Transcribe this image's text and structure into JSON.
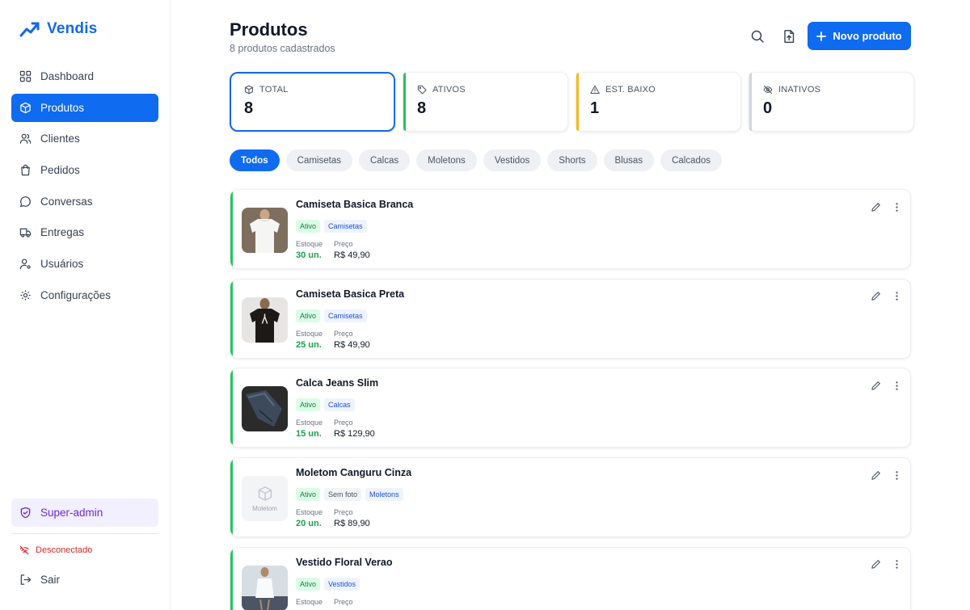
{
  "brand": {
    "name": "Vendis",
    "color": "#1467e8"
  },
  "sidebar": {
    "items": [
      {
        "label": "Dashboard",
        "icon": "grid-icon"
      },
      {
        "label": "Produtos",
        "icon": "box-icon",
        "active": true
      },
      {
        "label": "Clientes",
        "icon": "users-icon"
      },
      {
        "label": "Pedidos",
        "icon": "bag-icon"
      },
      {
        "label": "Conversas",
        "icon": "chat-icon"
      },
      {
        "label": "Entregas",
        "icon": "truck-icon"
      },
      {
        "label": "Usuários",
        "icon": "user-gear-icon"
      },
      {
        "label": "Configurações",
        "icon": "gear-icon"
      }
    ],
    "superadmin": "Super-admin",
    "status": "Desconectado",
    "logout": "Sair"
  },
  "header": {
    "title": "Produtos",
    "subtitle": "8 produtos cadastrados",
    "new_button": "Novo produto"
  },
  "stats": [
    {
      "label": "TOTAL",
      "value": "8",
      "color": "#1467e8",
      "icon": "box-icon"
    },
    {
      "label": "ATIVOS",
      "value": "8",
      "color": "#22c55e",
      "icon": "tag-icon"
    },
    {
      "label": "EST. BAIXO",
      "value": "1",
      "color": "#f5b91a",
      "icon": "warning-icon"
    },
    {
      "label": "INATIVOS",
      "value": "0",
      "color": "#d1d5db",
      "icon": "eye-off-icon"
    }
  ],
  "filters": [
    "Todos",
    "Camisetas",
    "Calcas",
    "Moletons",
    "Vestidos",
    "Shorts",
    "Blusas",
    "Calcados"
  ],
  "products": [
    {
      "name": "Camiseta Basica Branca",
      "status": "Ativo",
      "category": "Camisetas",
      "stock_label": "Estoque",
      "stock": "30 un.",
      "price_label": "Preço",
      "price": "R$ 49,90"
    },
    {
      "name": "Camiseta Basica Preta",
      "status": "Ativo",
      "category": "Camisetas",
      "stock_label": "Estoque",
      "stock": "25 un.",
      "price_label": "Preço",
      "price": "R$ 49,90"
    },
    {
      "name": "Calca Jeans Slim",
      "status": "Ativo",
      "category": "Calcas",
      "stock_label": "Estoque",
      "stock": "15 un.",
      "price_label": "Preço",
      "price": "R$ 129,90"
    },
    {
      "name": "Moletom Canguru Cinza",
      "status": "Ativo",
      "nofoto": "Sem foto",
      "thumb_label": "Moletom",
      "category": "Moletons",
      "stock_label": "Estoque",
      "stock": "20 un.",
      "price_label": "Preço",
      "price": "R$ 89,90"
    },
    {
      "name": "Vestido Floral Verao",
      "status": "Ativo",
      "category": "Vestidos",
      "stock_label": "Estoque",
      "stock": "",
      "price_label": "Preço",
      "price": ""
    }
  ]
}
